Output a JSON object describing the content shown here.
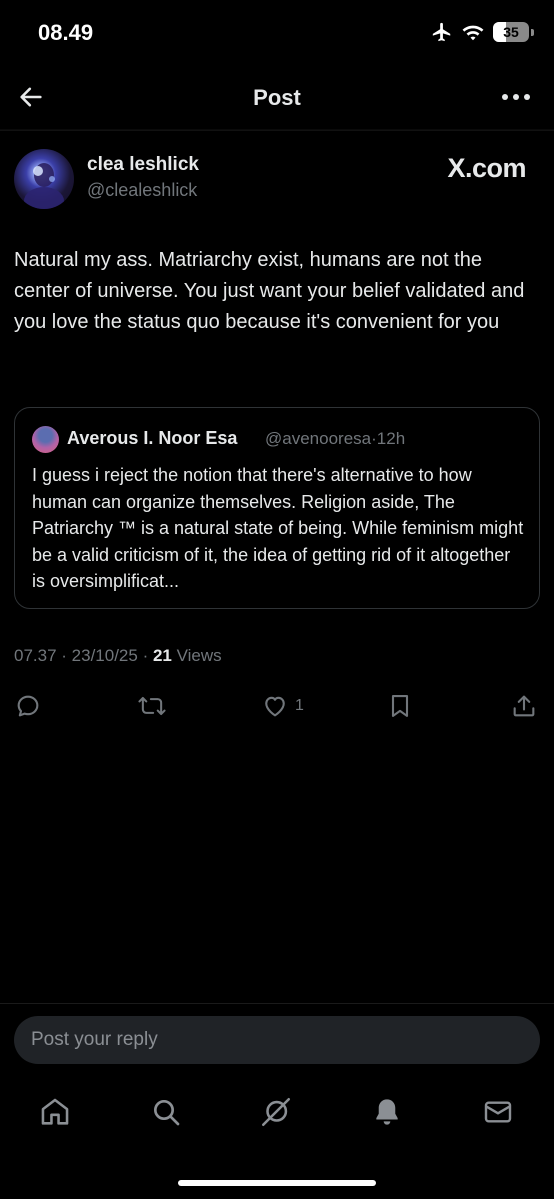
{
  "status_bar": {
    "time": "08.49",
    "battery": "35",
    "battery_level": 0.35
  },
  "header": {
    "title": "Post"
  },
  "post": {
    "author_name": "clea leshlick",
    "author_handle": "@clealeshlick",
    "badge": "X.com",
    "text": "Natural my ass. Matriarchy exist, humans are not the center of universe. You just want your belief validated and you love the status quo because it's convenient for you",
    "time": "07.37",
    "date": "23/10/25",
    "views_count": "21",
    "views_label": "Views",
    "likes": "1"
  },
  "quote": {
    "author_name": "Averous I. Noor Esa",
    "author_handle": "@avenooresa",
    "separator": "·",
    "time_ago": "12h",
    "text": "I guess i reject the notion that there's alternative to how human can organize themselves. Religion aside, The Patriarchy ™ is a natural state of being. While feminism might be a valid criticism of it, the idea of getting rid of it altogether is oversimplificat..."
  },
  "reply": {
    "placeholder": "Post your reply"
  },
  "colors": {
    "background": "#000000",
    "text": "#e7e9ea",
    "muted": "#71767b",
    "border": "#2f3336",
    "input_bg": "#202327"
  },
  "icons": {
    "header": [
      "back-arrow-icon",
      "more-icon"
    ],
    "status": [
      "airplane-icon",
      "wifi-icon",
      "battery-icon"
    ],
    "actions": [
      "reply-icon",
      "repost-icon",
      "like-icon",
      "bookmark-icon",
      "share-icon"
    ],
    "nav": [
      "home-icon",
      "search-icon",
      "grok-icon",
      "notifications-icon",
      "messages-icon"
    ]
  }
}
